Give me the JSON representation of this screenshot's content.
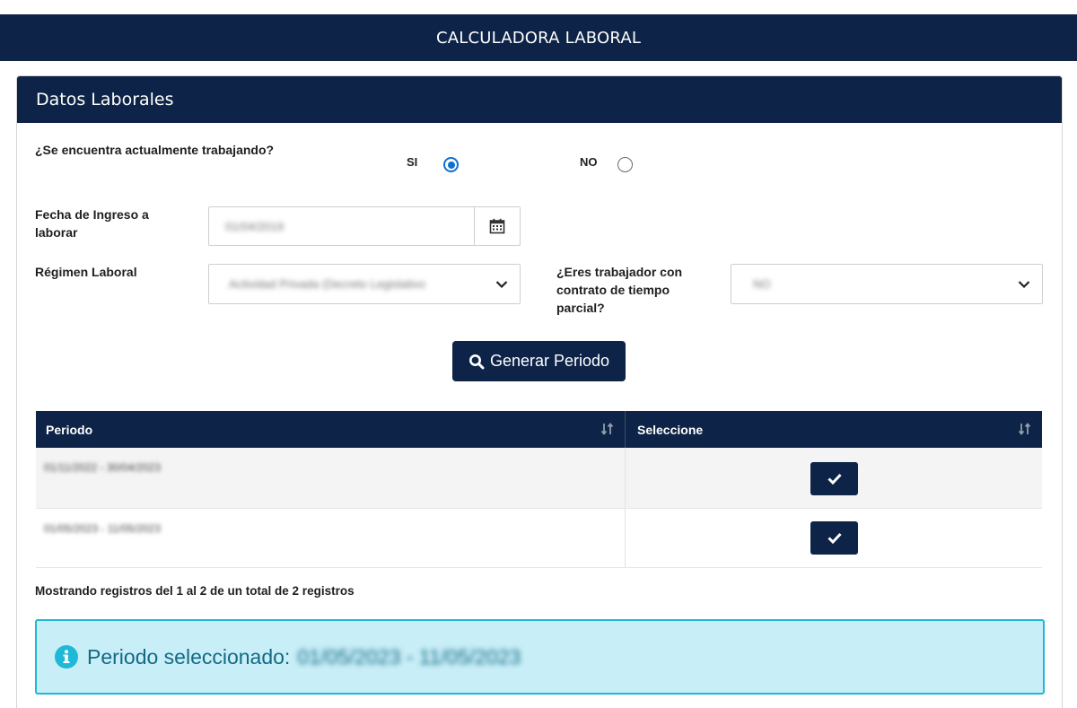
{
  "topbar": {
    "title": "CALCULADORA LABORAL"
  },
  "card": {
    "title": "Datos Laborales"
  },
  "working": {
    "question": "¿Se encuentra actualmente trabajando?",
    "options": [
      {
        "label": "SI",
        "checked": true
      },
      {
        "label": "NO",
        "checked": false
      }
    ]
  },
  "fecha": {
    "label_line1": "Fecha de Ingreso a",
    "label_line2": "laborar",
    "value": "01/04/2019",
    "icon": "calendar-icon"
  },
  "regimen": {
    "label": "Régimen Laboral",
    "value": "Actividad Privada (Decreto Legislativo",
    "icon": "chevron-down-icon"
  },
  "parcial": {
    "label_line1": "¿Eres trabajador con",
    "label_line2": "contrato de tiempo",
    "label_line3": "parcial?",
    "value": "NO",
    "icon": "chevron-down-icon"
  },
  "generate_button": {
    "label": "Generar Periodo",
    "icon": "search-icon"
  },
  "table": {
    "columns": [
      "Periodo",
      "Seleccione"
    ],
    "rows": [
      {
        "periodo": "01/11/2022 - 30/04/2023"
      },
      {
        "periodo": "01/05/2023 - 11/05/2023"
      }
    ]
  },
  "summary": "Mostrando registros del 1 al 2 de un total de 2 registros",
  "alert": {
    "label": "Periodo seleccionado:",
    "value": "01/05/2023 - 11/05/2023",
    "icon": "info-icon"
  },
  "colors": {
    "navy": "#0d2347",
    "radio_blue": "#0f6fd1",
    "alert_bg": "#c8eef7",
    "alert_border": "#1fb9d8",
    "alert_text": "#136a84"
  }
}
